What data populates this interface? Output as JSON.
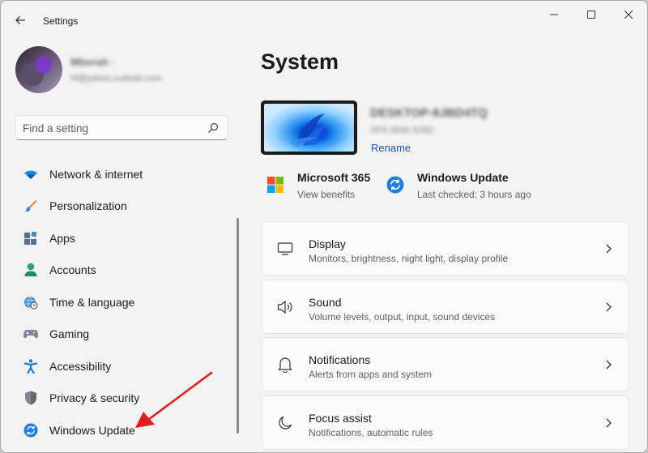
{
  "window": {
    "title": "Settings"
  },
  "profile": {
    "name": "Mborah ·",
    "email": "hf@yahoo.outlook.com"
  },
  "search": {
    "placeholder": "Find a setting"
  },
  "sidebar": {
    "items": [
      {
        "label": "Network & internet",
        "icon": "wifi-icon"
      },
      {
        "label": "Personalization",
        "icon": "brush-icon"
      },
      {
        "label": "Apps",
        "icon": "apps-icon"
      },
      {
        "label": "Accounts",
        "icon": "person-icon"
      },
      {
        "label": "Time & language",
        "icon": "globe-clock-icon"
      },
      {
        "label": "Gaming",
        "icon": "gamepad-icon"
      },
      {
        "label": "Accessibility",
        "icon": "accessibility-icon"
      },
      {
        "label": "Privacy & security",
        "icon": "shield-icon"
      },
      {
        "label": "Windows Update",
        "icon": "update-icon"
      }
    ]
  },
  "main": {
    "title": "System",
    "device": {
      "name": "DESKTOP-8JBD4TQ",
      "model": "XPS 8930 9J5D",
      "rename_label": "Rename"
    },
    "quick_links": [
      {
        "title": "Microsoft 365",
        "subtitle": "View benefits",
        "icon": "microsoft-logo-icon"
      },
      {
        "title": "Windows Update",
        "subtitle": "Last checked: 3 hours ago",
        "icon": "update-icon"
      }
    ],
    "cards": [
      {
        "title": "Display",
        "subtitle": "Monitors, brightness, night light, display profile",
        "icon": "monitor-icon"
      },
      {
        "title": "Sound",
        "subtitle": "Volume levels, output, input, sound devices",
        "icon": "speaker-icon"
      },
      {
        "title": "Notifications",
        "subtitle": "Alerts from apps and system",
        "icon": "bell-icon"
      },
      {
        "title": "Focus assist",
        "subtitle": "Notifications, automatic rules",
        "icon": "moon-icon"
      }
    ]
  },
  "colors": {
    "accent": "#0067c0",
    "link": "#1a5a9e",
    "annotation_arrow": "#e02020",
    "window_bg": "#f3f3f3",
    "card_bg": "#fbfbfb"
  }
}
